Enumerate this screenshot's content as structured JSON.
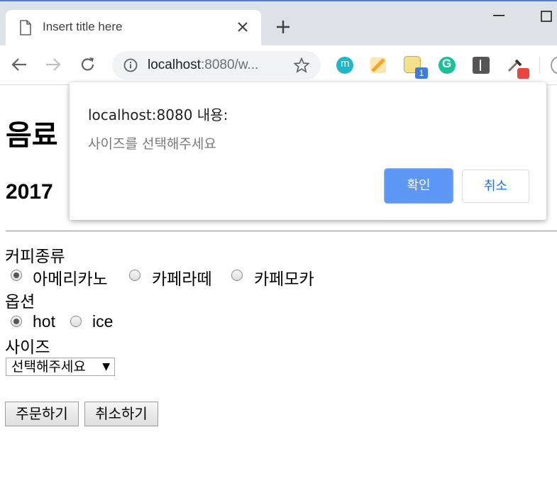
{
  "browser": {
    "tab_title": "Insert title here",
    "url_host": "localhost",
    "url_rest": ":8080/w...",
    "extension_badge": "1"
  },
  "page": {
    "heading1": "음료",
    "heading2": "2017",
    "coffee_label": "커피종류",
    "coffee_options": [
      "아메리카노",
      "카페라떼",
      "카페모카"
    ],
    "option_label": "옵션",
    "temp_options": [
      "hot",
      "ice"
    ],
    "size_label": "사이즈",
    "size_select_value": "선택해주세요",
    "order_button": "주문하기",
    "cancel_button": "취소하기"
  },
  "dialog": {
    "title": "localhost:8080 내용:",
    "message": "사이즈를 선택해주세요",
    "ok_label": "확인",
    "cancel_label": "취소"
  }
}
